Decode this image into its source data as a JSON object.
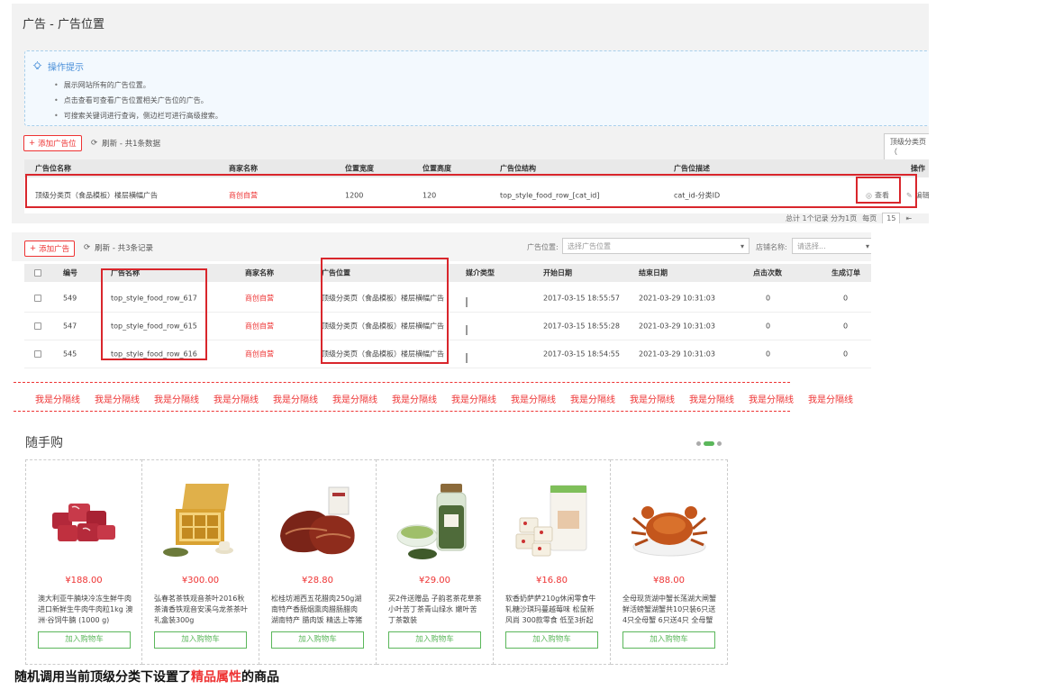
{
  "panel1": {
    "title": "广告 - 广告位置",
    "tips": {
      "header": "操作提示",
      "items": [
        "展示网站所有的广告位置。",
        "点击查看可查看广告位置相关广告位的广告。",
        "可搜索关键词进行查询，侧边栏可进行高级搜索。"
      ]
    },
    "add_label": "添加广告位",
    "refresh_label": "刷新 - 共1条数据",
    "dropdown_label": "顶级分类页（",
    "columns": [
      "广告位名称",
      "商家名称",
      "位置宽度",
      "位置高度",
      "广告位结构",
      "广告位描述",
      "操作"
    ],
    "row": {
      "name": "顶级分类页（食品模板）楼层横幅广告",
      "merchant": "商创自营",
      "width": "1200",
      "height": "120",
      "structure": "top_style_food_row_[cat_id]",
      "desc": "cat_id-分类ID",
      "view": "查看",
      "edit": "编辑"
    },
    "pager": {
      "total": "总计 1个记录 分为1页",
      "per_page_label": "每页",
      "per_page": "15",
      "first": "⇤"
    }
  },
  "panel2": {
    "add_label": "添加广告",
    "refresh_label": "刷新 - 共3条记录",
    "position_label": "广告位置:",
    "position_placeholder": "选择广告位置",
    "shop_label": "店铺名称:",
    "shop_placeholder": "请选择...",
    "columns": [
      "编号",
      "广告名称",
      "商家名称",
      "广告位置",
      "媒介类型",
      "开始日期",
      "结束日期",
      "点击次数",
      "生成订单"
    ],
    "rows": [
      {
        "id": "549",
        "name": "top_style_food_row_617",
        "merchant": "商创自营",
        "position": "顶级分类页（食品模板）楼层横幅广告",
        "start": "2017-03-15 18:55:57",
        "end": "2021-03-29 10:31:03",
        "clicks": "0",
        "orders": "0"
      },
      {
        "id": "547",
        "name": "top_style_food_row_615",
        "merchant": "商创自营",
        "position": "顶级分类页（食品模板）楼层横幅广告",
        "start": "2017-03-15 18:55:28",
        "end": "2021-03-29 10:31:03",
        "clicks": "0",
        "orders": "0"
      },
      {
        "id": "545",
        "name": "top_style_food_row_616",
        "merchant": "商创自营",
        "position": "顶级分类页（食品模板）楼层横幅广告",
        "start": "2017-03-15 18:54:55",
        "end": "2021-03-29 10:31:03",
        "clicks": "0",
        "orders": "0"
      }
    ]
  },
  "separator": {
    "label": "我是分隔线",
    "count": 14
  },
  "section": {
    "title": "随手购",
    "products": [
      {
        "price": "¥188.00",
        "name": "澳大利亚牛腩块冷冻生鲜牛肉 进口新鲜生牛肉牛肉粒1kg 澳洲·谷饲牛腩 (1000 g)",
        "button": "加入购物车",
        "icon": "beef-cubes"
      },
      {
        "price": "¥300.00",
        "name": "弘春茗茶铁观音茶叶2016秋茶清香铁观音安溪乌龙茶茶叶礼盒装300g",
        "button": "加入购物车",
        "icon": "tea-gift-box"
      },
      {
        "price": "¥28.80",
        "name": "松桂坊湘西五花腊肉250g湖南特产香肠烟熏肉腊肠腊肉 湖南特产 腊肉饭 精选上等猪",
        "button": "加入购物车",
        "icon": "smoked-pork"
      },
      {
        "price": "¥29.00",
        "name": "买2件送赠品 子韵茗茶花草茶 小叶苦丁茶青山绿水 嫩叶苦丁茶散装",
        "button": "加入购物车",
        "icon": "green-tea-jar"
      },
      {
        "price": "¥16.80",
        "name": "软香奶萨萨210g休闲零食牛轧糖沙琪玛蔓越莓味 松鼠新风尚 300款零食 低至3折起",
        "button": "加入购物车",
        "icon": "nougat-snack"
      },
      {
        "price": "¥88.00",
        "name": "全母现货湖中蟹长荡湖大闸蟹 鲜活螃蟹湖蟹共10只装6只送4只全母蟹 6只送4只 全母蟹",
        "button": "加入购物车",
        "icon": "hairy-crab"
      }
    ]
  },
  "caption": {
    "prefix": "随机调用当前顶级分类下设置了",
    "highlight": "精品属性",
    "suffix": "的商品"
  },
  "colors": {
    "red": "#e33",
    "green": "#5bb75b",
    "tip_blue": "#4a90d9"
  }
}
